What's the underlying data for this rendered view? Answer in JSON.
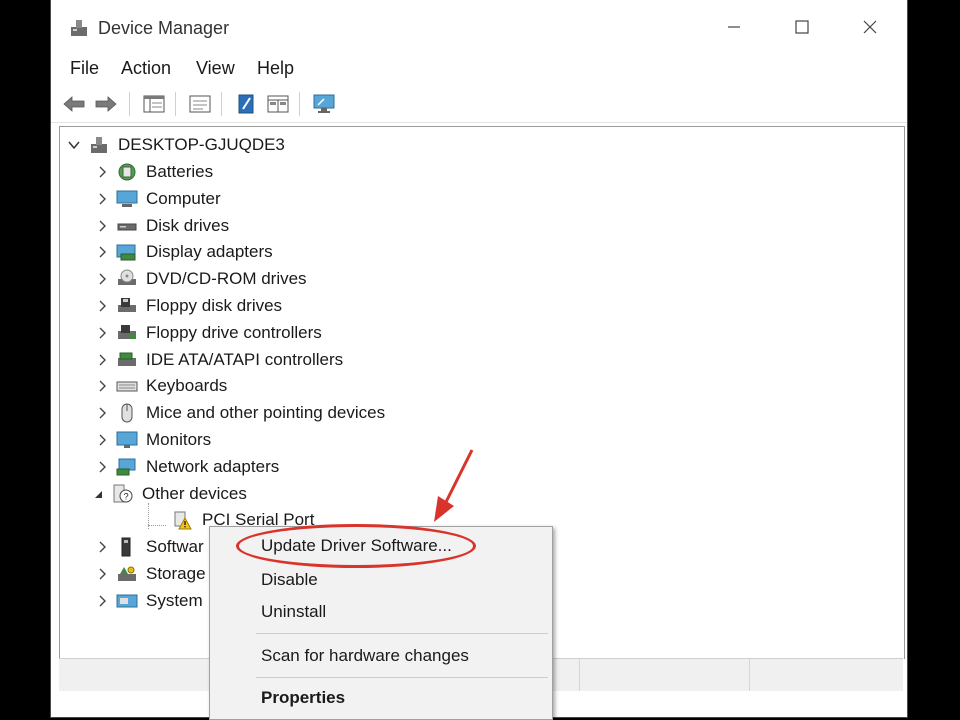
{
  "window": {
    "title": "Device Manager",
    "minimize": "—",
    "maximize": "☐",
    "close": "✕"
  },
  "menu": [
    "File",
    "Action",
    "View",
    "Help"
  ],
  "toolbar": [
    "back-icon",
    "forward-icon",
    "properties-icon",
    "help-icon",
    "update-driver-icon",
    "view-devices-icon",
    "scan-hardware-icon"
  ],
  "tree": {
    "root": "DESKTOP-GJUQDE3",
    "categories": [
      {
        "label": "Batteries",
        "icon": "battery-icon"
      },
      {
        "label": "Computer",
        "icon": "computer-icon"
      },
      {
        "label": "Disk drives",
        "icon": "disk-drive-icon"
      },
      {
        "label": "Display adapters",
        "icon": "display-adapter-icon"
      },
      {
        "label": "DVD/CD-ROM drives",
        "icon": "dvd-icon"
      },
      {
        "label": "Floppy disk drives",
        "icon": "floppy-disk-icon"
      },
      {
        "label": "Floppy drive controllers",
        "icon": "floppy-controller-icon"
      },
      {
        "label": "IDE ATA/ATAPI controllers",
        "icon": "ide-controller-icon"
      },
      {
        "label": "Keyboards",
        "icon": "keyboard-icon"
      },
      {
        "label": "Mice and other pointing devices",
        "icon": "mouse-icon"
      },
      {
        "label": "Monitors",
        "icon": "monitor-icon"
      },
      {
        "label": "Network adapters",
        "icon": "network-adapter-icon"
      },
      {
        "label": "Other devices",
        "icon": "unknown-device-icon"
      },
      {
        "label": "Softwar",
        "icon": "software-device-icon"
      },
      {
        "label": "Storage",
        "icon": "storage-controller-icon"
      },
      {
        "label": "System",
        "icon": "system-device-icon"
      }
    ],
    "child": {
      "label": "PCI Serial Port",
      "icon": "warning-device-icon"
    }
  },
  "context_menu": {
    "items": [
      "Update Driver Software...",
      "Disable",
      "Uninstall",
      "Scan for hardware changes",
      "Properties"
    ]
  },
  "colors": {
    "annotation": "#d9342b",
    "accent": "#2b6fb6"
  }
}
